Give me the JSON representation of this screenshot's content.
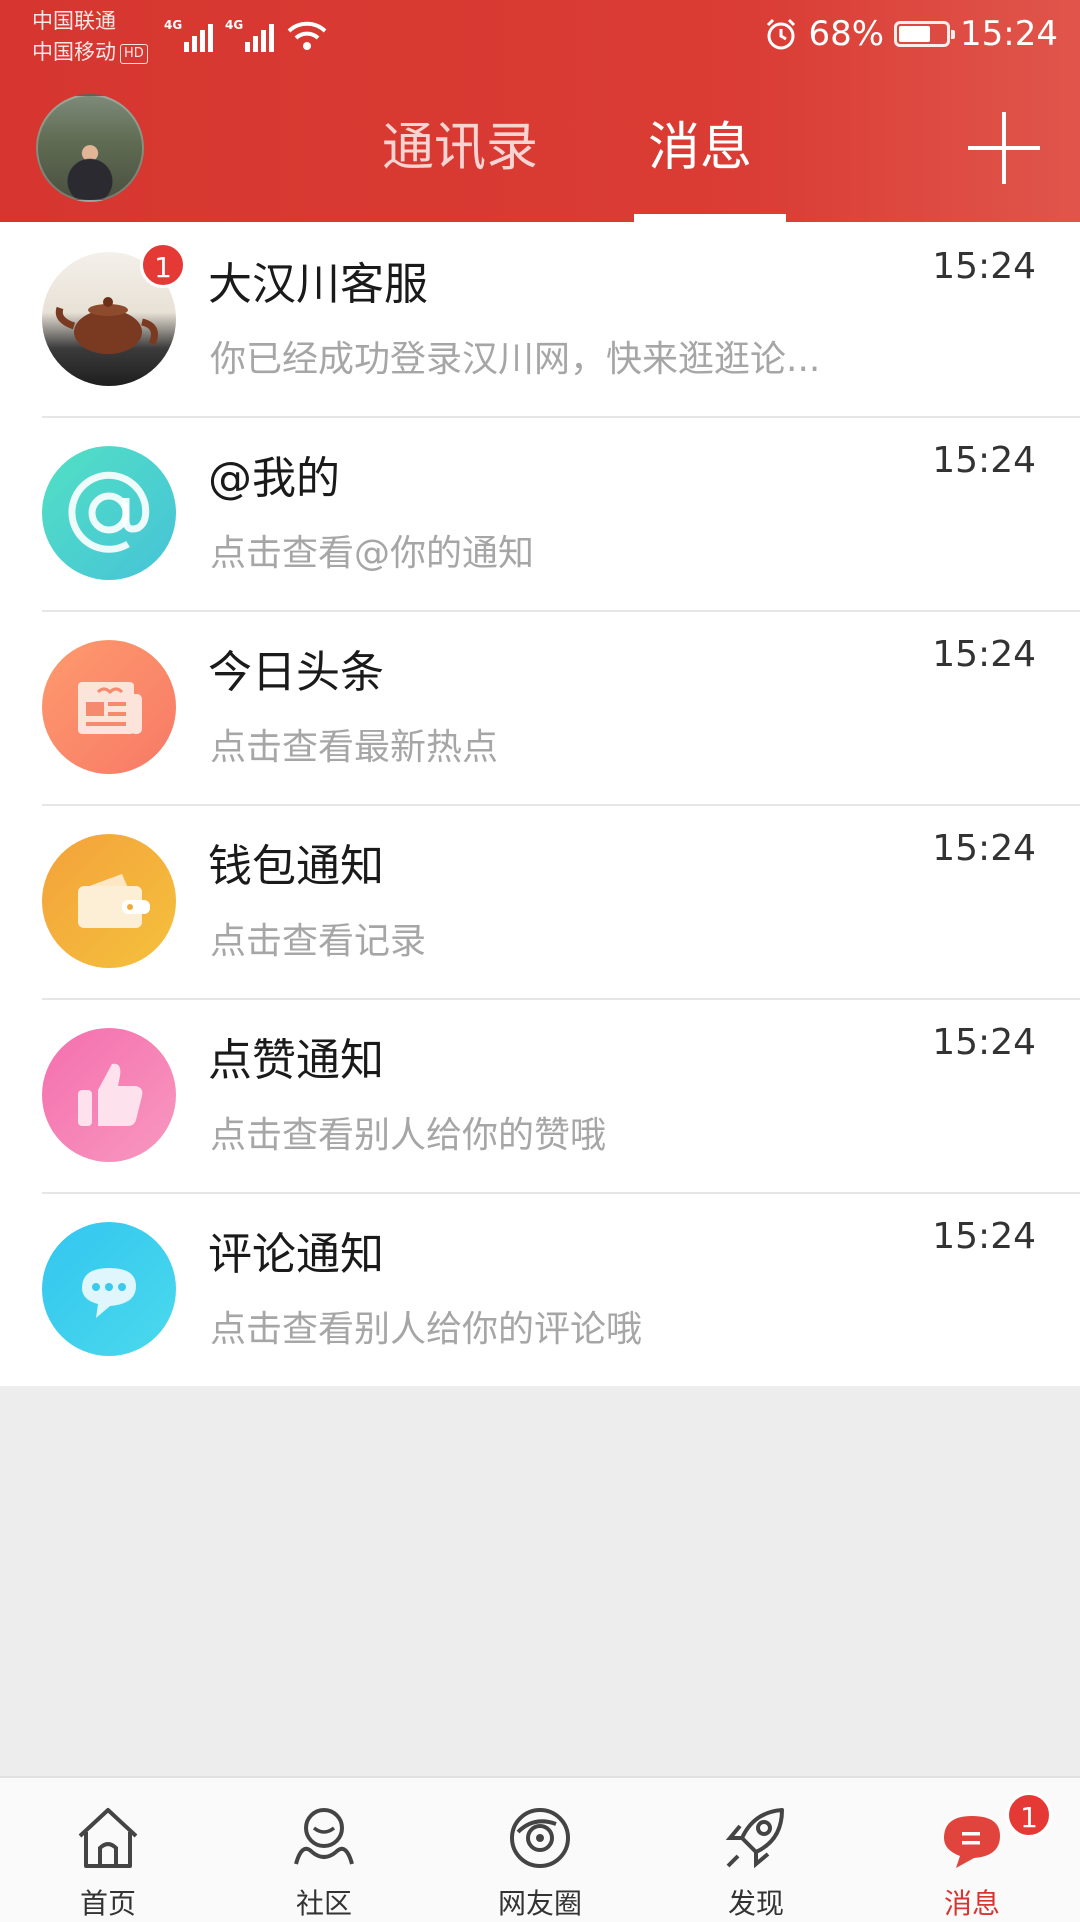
{
  "status_bar": {
    "carrier_1": "中国联通",
    "carrier_2": "中国移动",
    "hd": "HD",
    "signal_1": "4G",
    "signal_2": "4G",
    "battery_percent": "68%",
    "battery_level": 0.68,
    "time": "15:24"
  },
  "header": {
    "tabs": [
      {
        "label": "通讯录",
        "active": false
      },
      {
        "label": "消息",
        "active": true
      }
    ]
  },
  "messages": [
    {
      "title": "大汉川客服",
      "subtitle": "你已经成功登录汉川网，快来逛逛论...",
      "time": "15:24",
      "unread": "1",
      "icon": "teapot-avatar"
    },
    {
      "title": "@我的",
      "subtitle": "点击查看@你的通知",
      "time": "15:24",
      "icon": "at-icon",
      "color": "#4fd6c0"
    },
    {
      "title": "今日头条",
      "subtitle": "点击查看最新热点",
      "time": "15:24",
      "icon": "newspaper-icon",
      "color": "#fb8a6b"
    },
    {
      "title": "钱包通知",
      "subtitle": "点击查看记录",
      "time": "15:24",
      "icon": "wallet-icon",
      "color": "#f5a623"
    },
    {
      "title": "点赞通知",
      "subtitle": "点击查看别人给你的赞哦",
      "time": "15:24",
      "icon": "thumbs-up-icon",
      "color": "#f27db6"
    },
    {
      "title": "评论通知",
      "subtitle": "点击查看别人给你的评论哦",
      "time": "15:24",
      "icon": "comment-icon",
      "color": "#3fcfee"
    }
  ],
  "bottom_nav": [
    {
      "label": "首页",
      "icon": "home-icon"
    },
    {
      "label": "社区",
      "icon": "community-icon"
    },
    {
      "label": "网友圈",
      "icon": "planet-icon"
    },
    {
      "label": "发现",
      "icon": "rocket-icon"
    },
    {
      "label": "消息",
      "icon": "message-icon",
      "active": true,
      "badge": "1"
    }
  ],
  "colors": {
    "brand_red": "#d6362f",
    "badge_red": "#e53935"
  }
}
